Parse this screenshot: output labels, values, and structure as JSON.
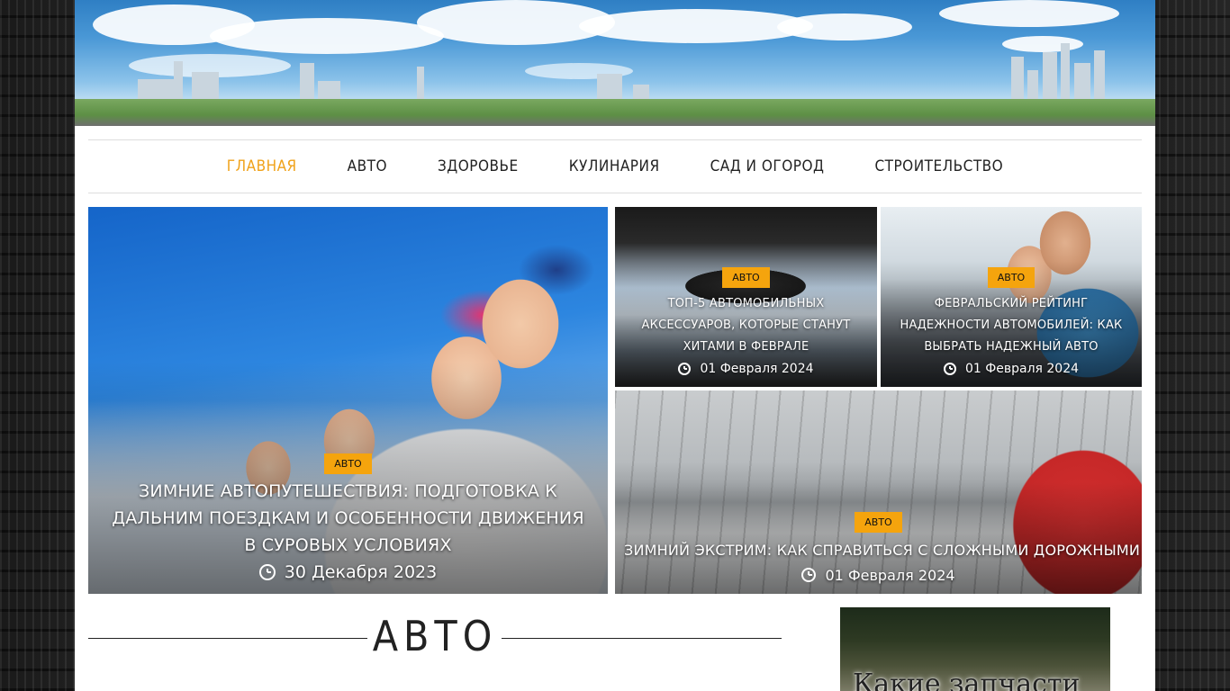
{
  "nav": {
    "items": [
      {
        "label": "ГЛАВНАЯ",
        "active": true
      },
      {
        "label": "АВТО",
        "active": false
      },
      {
        "label": "ЗДОРОВЬЕ",
        "active": false
      },
      {
        "label": "КУЛИНАРИЯ",
        "active": false
      },
      {
        "label": "САД И ОГОРОД",
        "active": false
      },
      {
        "label": "СТРОИТЕЛЬСТВО",
        "active": false
      }
    ]
  },
  "featured": {
    "main": {
      "category": "АВТО",
      "title": "ЗИМНИЕ АВТОПУТЕШЕСТВИЯ: ПОДГОТОВКА К ДАЛЬНИМ ПОЕЗДКАМ И ОСОБЕННОСТИ ДВИЖЕНИЯ В СУРОВЫХ УСЛОВИЯХ",
      "date": "30 Декабря 2023"
    },
    "top_left": {
      "category": "АВТО",
      "title": "ТОП-5 АВТОМОБИЛЬНЫХ АКСЕССУАРОВ, КОТОРЫЕ СТАНУТ ХИТАМИ В ФЕВРАЛЕ",
      "date": "01 Февраля 2024"
    },
    "top_right": {
      "category": "АВТО",
      "title": "ФЕВРАЛЬСКИЙ РЕЙТИНГ НАДЕЖНОСТИ АВТОМОБИЛЕЙ: КАК ВЫБРАТЬ НАДЕЖНЫЙ АВТО",
      "date": "01 Февраля 2024"
    },
    "bottom": {
      "category": "АВТО",
      "title": "ЗИМНИЙ ЭКСТРИМ: КАК СПРАВИТЬСЯ С СЛОЖНЫМИ ДОРОЖНЫМИ УСЛОВИЯМИ",
      "date": "01 Февраля 2024"
    }
  },
  "section": {
    "title": "АВТО"
  },
  "sidebar": {
    "ad_text": "Какие запчасти"
  },
  "colors": {
    "accent": "#f5a40d",
    "nav_active": "#f0a21a"
  }
}
